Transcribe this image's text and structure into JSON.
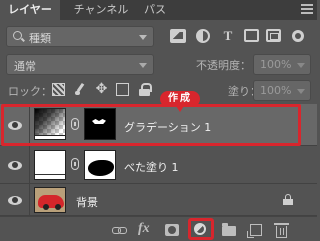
{
  "tabs": [
    {
      "label": "レイヤー",
      "active": true
    },
    {
      "label": "チャンネル",
      "active": false
    },
    {
      "label": "パス",
      "active": false
    }
  ],
  "filter": {
    "kind_label": "種類"
  },
  "blend": {
    "mode": "通常",
    "opacity_label": "不透明度：",
    "opacity_value": "100%"
  },
  "lock": {
    "label": "ロック：",
    "fill_label": "塗り：",
    "fill_value": "100%"
  },
  "layers": [
    {
      "name": "グラデーション 1",
      "selected": true
    },
    {
      "name": "べた塗り 1",
      "selected": false
    },
    {
      "name": "背景",
      "selected": false,
      "locked": true
    }
  ],
  "annotation": {
    "label": "作成",
    "color": "#d8262d"
  },
  "colors": {
    "panel": "#535353",
    "tabbar": "#3d3d3d",
    "selected_row": "#686868",
    "highlight": "#d8262d"
  }
}
